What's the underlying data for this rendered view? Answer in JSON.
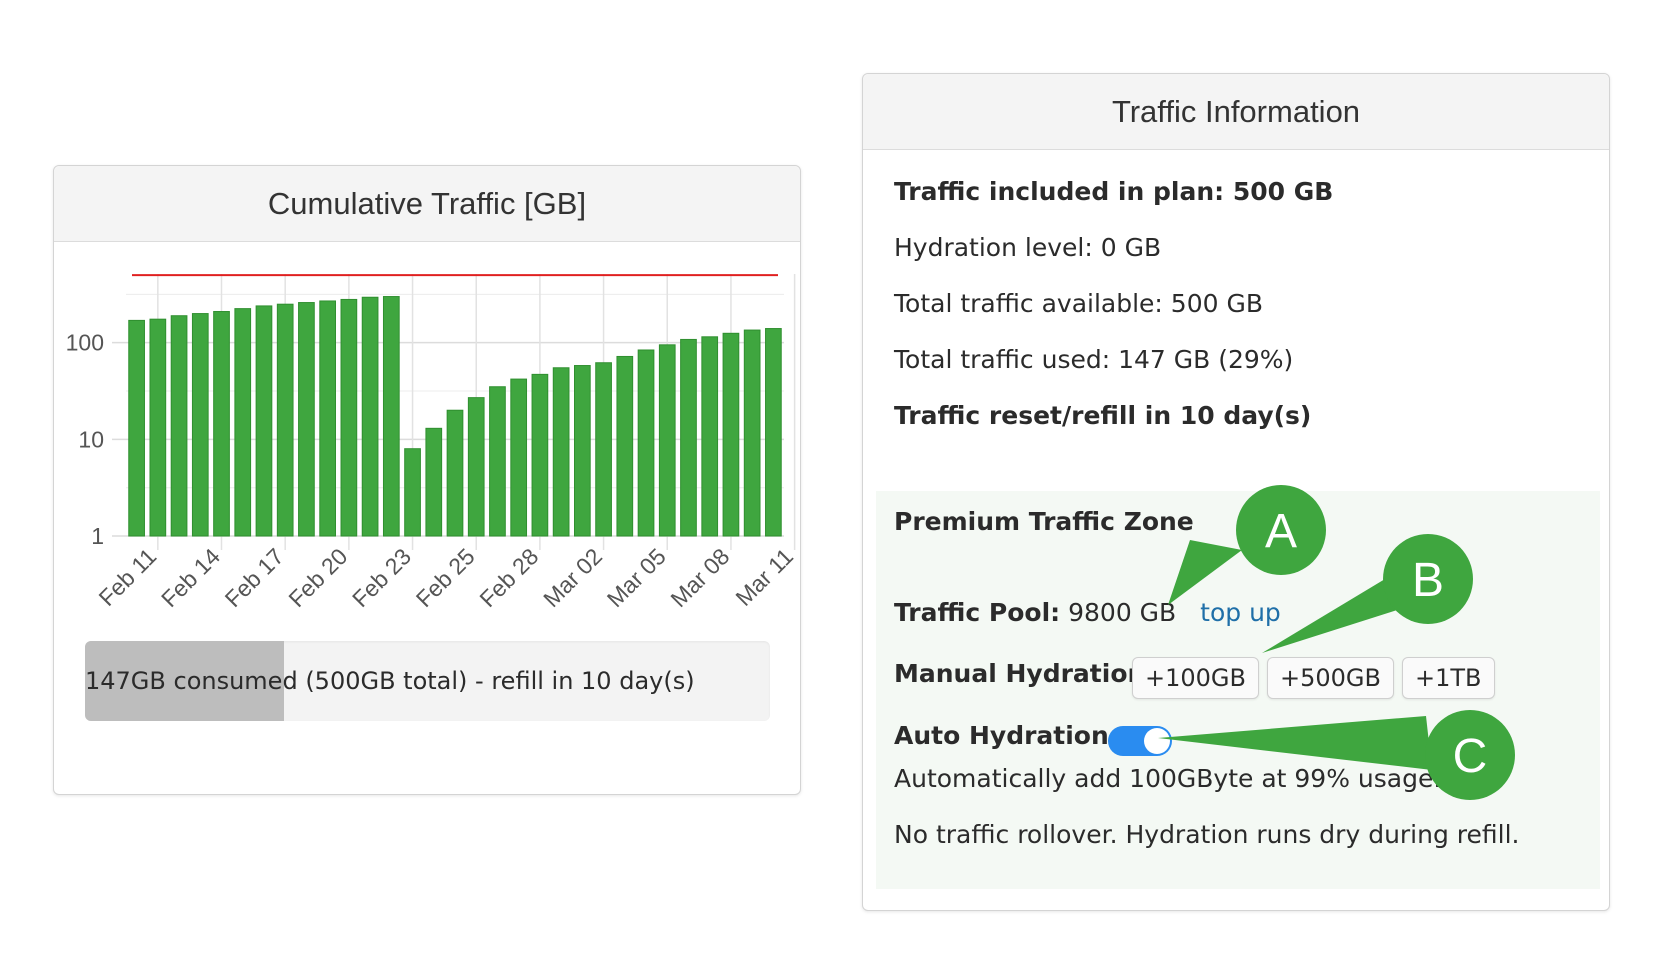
{
  "chart_panel": {
    "title": "Cumulative Traffic [GB]",
    "progress": {
      "consumed_label": "147GB consumed",
      "rest_label": " (500GB total) - refill in 10 day(s)",
      "fraction": 0.29
    }
  },
  "chart_data": {
    "type": "bar",
    "y_scale": "log",
    "ylim": [
      1,
      1000
    ],
    "y_ticks": [
      "1",
      "10",
      "100"
    ],
    "x_tick_labels": [
      "Feb 11",
      "Feb 14",
      "Feb 17",
      "Feb 20",
      "Feb 23",
      "Feb 25",
      "Feb 28",
      "Mar 02",
      "Mar 05",
      "Mar 08",
      "Mar 11"
    ],
    "values": [
      170,
      175,
      190,
      200,
      210,
      225,
      240,
      250,
      260,
      270,
      280,
      295,
      300,
      8,
      13,
      20,
      27,
      35,
      42,
      47,
      55,
      58,
      62,
      72,
      84,
      95,
      108,
      115,
      125,
      135,
      140
    ],
    "limit_line": 500,
    "bar_color": "#3fa63f",
    "limit_color": "#e02020",
    "grid": true
  },
  "info_panel": {
    "title": "Traffic Information",
    "lines": {
      "included": "Traffic included in plan: 500 GB",
      "hydration_level": "Hydration level: 0 GB",
      "total_available": "Total traffic available: 500 GB",
      "total_used": "Total traffic used: 147 GB (29%)",
      "reset": "Traffic reset/refill in 10 day(s)"
    },
    "zone": {
      "title": "Premium Traffic Zone",
      "pool_label": "Traffic Pool:",
      "pool_value": " 9800 GB",
      "top_up": "top up",
      "manual_label": "Manual Hydration",
      "buttons": [
        "+100GB",
        "+500GB",
        "+1TB"
      ],
      "auto_label": "Auto Hydration",
      "auto_enabled": true,
      "auto_desc": "Automatically add 100GByte at 99% usage.",
      "rollover_note": "No traffic rollover. Hydration runs dry during refill."
    }
  },
  "callouts": [
    "A",
    "B",
    "C"
  ],
  "colors": {
    "toggle_on": "#2a8cf0",
    "callout": "#3fa63f",
    "link": "#1f6fa8"
  }
}
